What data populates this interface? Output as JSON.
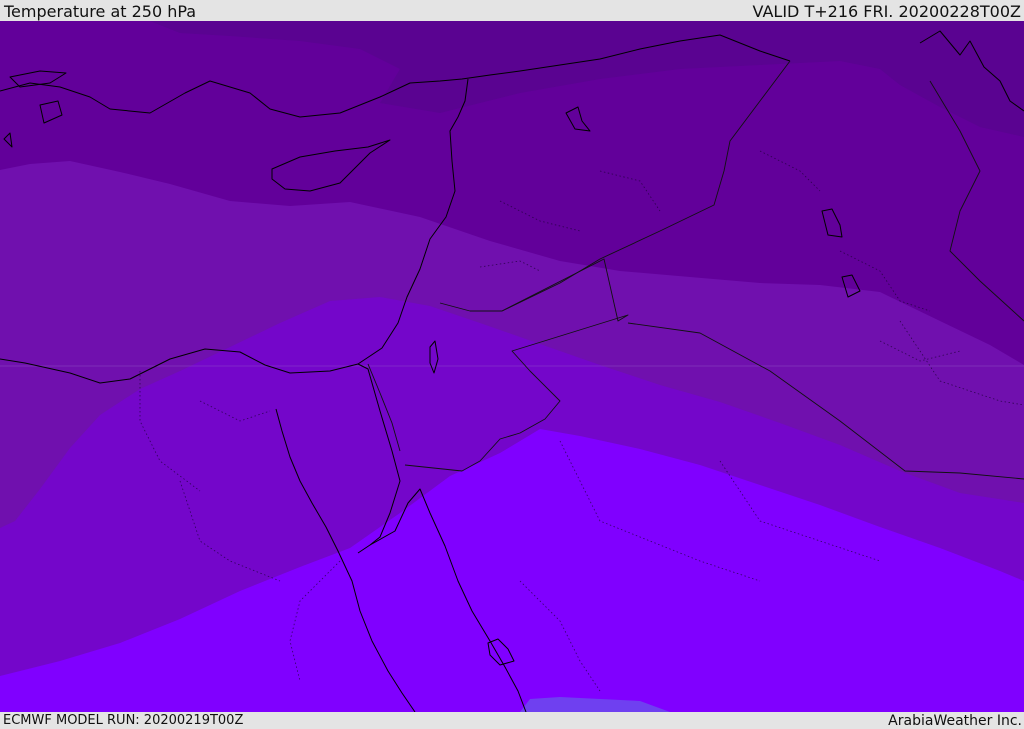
{
  "header": {
    "title": "Temperature at 250 hPa",
    "valid_time": "VALID T+216 FRI. 20200228T00Z"
  },
  "footer": {
    "model_run": "ECMWF MODEL RUN: 20200219T00Z",
    "credit": "ArabiaWeather Inc."
  },
  "map": {
    "fill_colors": [
      "#5a0391",
      "#62009a",
      "#7010ae",
      "#7406ca",
      "#7b00f1",
      "#8000ff",
      "#6f40f0"
    ],
    "coastline_color": "#000000",
    "grid_color": "#9966cc"
  }
}
